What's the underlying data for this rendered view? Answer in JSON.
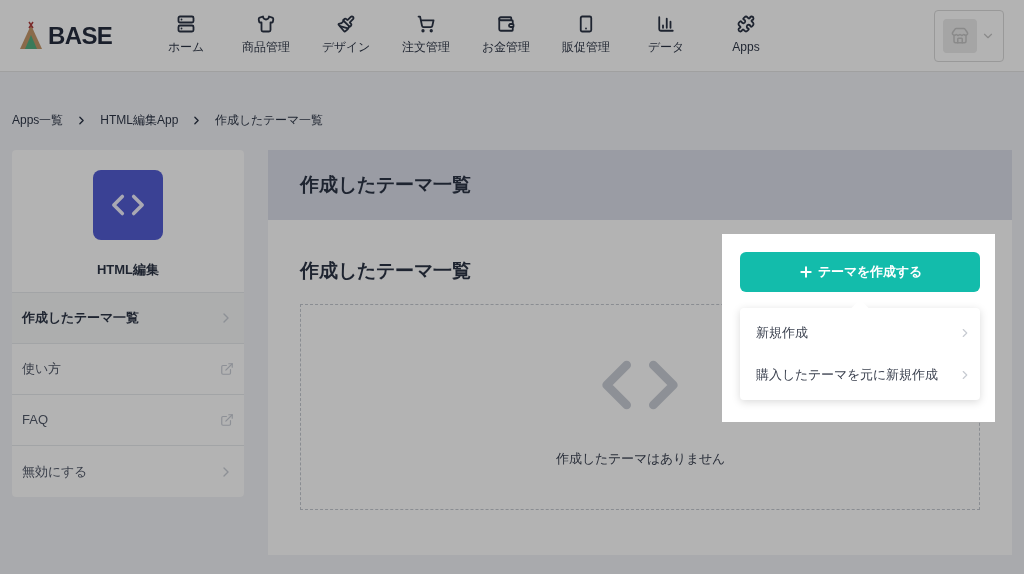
{
  "header": {
    "logo": "BASE",
    "nav": [
      {
        "label": "ホーム",
        "kind": "home"
      },
      {
        "label": "商品管理",
        "kind": "items"
      },
      {
        "label": "デザイン",
        "kind": "design"
      },
      {
        "label": "注文管理",
        "kind": "orders"
      },
      {
        "label": "お金管理",
        "kind": "money"
      },
      {
        "label": "販促管理",
        "kind": "promo"
      },
      {
        "label": "データ",
        "kind": "data"
      },
      {
        "label": "Apps",
        "kind": "apps"
      }
    ]
  },
  "breadcrumb": [
    "Apps一覧",
    "HTML編集App",
    "作成したテーマ一覧"
  ],
  "sidebar": {
    "app_name": "HTML編集",
    "items": [
      {
        "label": "作成したテーマ一覧",
        "selected": true,
        "kind": "page"
      },
      {
        "label": "使い方",
        "selected": false,
        "kind": "external"
      },
      {
        "label": "FAQ",
        "selected": false,
        "kind": "external"
      },
      {
        "label": "無効にする",
        "selected": false,
        "kind": "page"
      }
    ]
  },
  "main": {
    "header_title": "作成したテーマ一覧",
    "title": "作成したテーマ一覧",
    "empty_message": "作成したテーマはありません",
    "create_button": "テーマを作成する",
    "menu": [
      "新規作成",
      "購入したテーマを元に新規作成"
    ]
  }
}
